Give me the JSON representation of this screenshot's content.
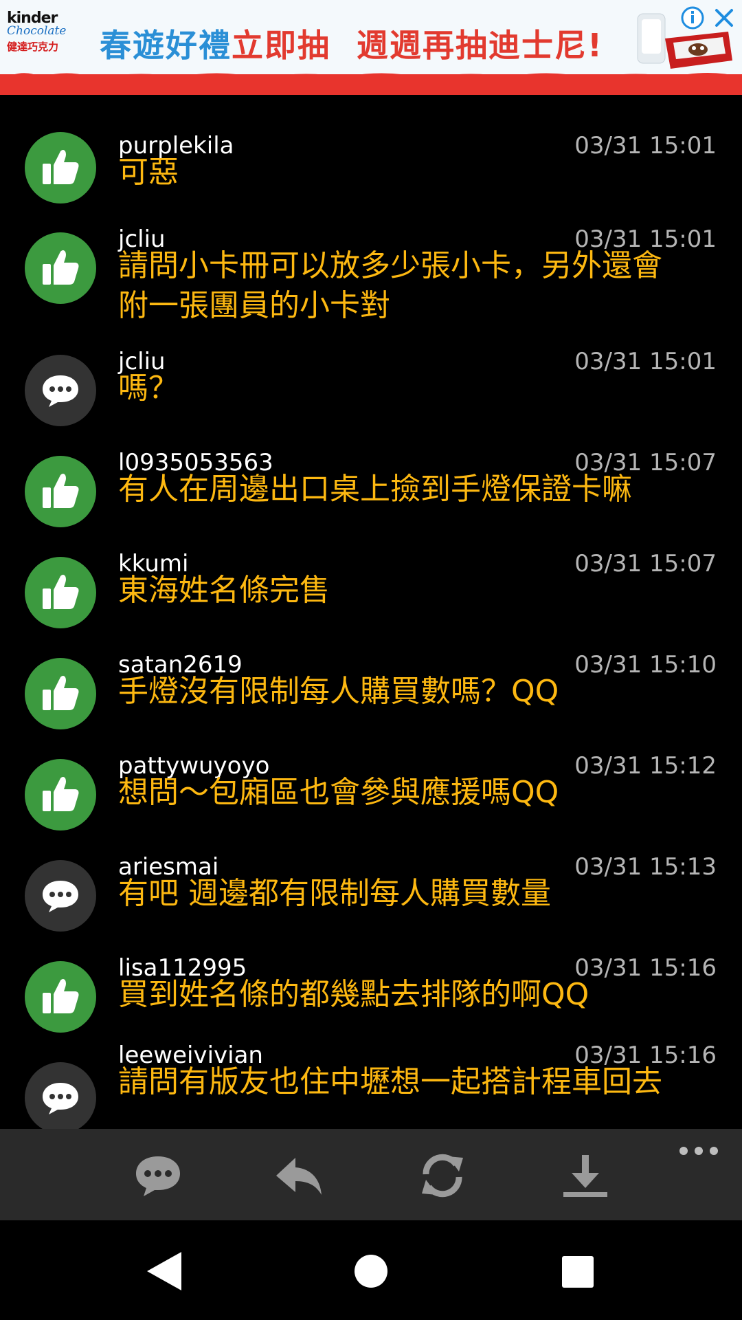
{
  "ad": {
    "logo_line1_a": "kinder",
    "logo_line2": "Chocolate",
    "logo_line3": "健達巧克力",
    "headline_part1": "春遊好禮",
    "headline_highlight": "立即抽",
    "headline_part2": "週週再抽迪士尼!",
    "colors": {
      "background": "#f4f9fc",
      "accent_blue": "#2a8fd6",
      "accent_red": "#e23a2f"
    }
  },
  "comments": [
    {
      "user": "purplekila",
      "time": "03/31 15:01",
      "type": "up",
      "lines": [
        "可惡"
      ]
    },
    {
      "user": "jcliu",
      "time": "03/31 15:01",
      "type": "up",
      "lines": [
        "請問小卡冊可以放多少張小卡，另外還會",
        "附一張團員的小卡對"
      ]
    },
    {
      "user": "jcliu",
      "time": "03/31 15:01",
      "type": "chat",
      "lines": [
        "嗎？"
      ]
    },
    {
      "user": "l0935053563",
      "time": "03/31 15:07",
      "type": "up",
      "lines": [
        "有人在周邊出口桌上撿到手燈保證卡嘛"
      ]
    },
    {
      "user": "kkumi",
      "time": "03/31 15:07",
      "type": "up",
      "lines": [
        "東海姓名條完售"
      ]
    },
    {
      "user": "satan2619",
      "time": "03/31 15:10",
      "type": "up",
      "lines": [
        "手燈沒有限制每人購買數嗎？QQ"
      ]
    },
    {
      "user": "pattywuyoyo",
      "time": "03/31 15:12",
      "type": "up",
      "lines": [
        "想問～包廂區也會參與應援嗎QQ"
      ]
    },
    {
      "user": "ariesmai",
      "time": "03/31 15:13",
      "type": "chat",
      "lines": [
        "有吧 週邊都有限制每人購買數量"
      ]
    },
    {
      "user": "lisa112995",
      "time": "03/31 15:16",
      "type": "up",
      "lines": [
        "買到姓名條的都幾點去排隊的啊QQ"
      ]
    },
    {
      "user": "leeweivivian",
      "time": "03/31 15:16",
      "type": "chat",
      "lines": [
        "請問有版友也住中壢想一起搭計程車回去"
      ]
    }
  ],
  "toolbar": {
    "buttons": [
      "comment-icon",
      "reply-icon",
      "refresh-icon",
      "download-icon"
    ],
    "more": "more-icon"
  },
  "colors": {
    "username": "#ffffff",
    "timestamp": "#b5b5b5",
    "message": "#fdb811",
    "upvote_avatar": "#3c9a3f",
    "chat_avatar": "#333333",
    "toolbar_bg": "#2a2a2a"
  }
}
